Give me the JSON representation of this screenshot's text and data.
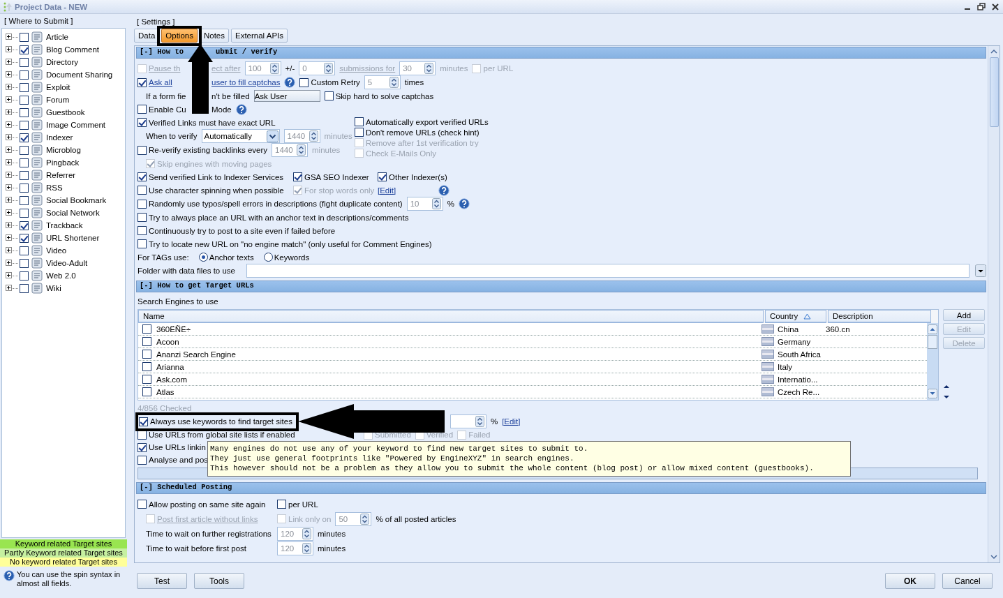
{
  "window": {
    "title": "Project Data - NEW"
  },
  "submit_panel": {
    "title": "[ Where to Submit ]",
    "items": [
      {
        "label": "Article",
        "checked": false
      },
      {
        "label": "Blog Comment",
        "checked": true
      },
      {
        "label": "Directory",
        "checked": false
      },
      {
        "label": "Document Sharing",
        "checked": false
      },
      {
        "label": "Exploit",
        "checked": false
      },
      {
        "label": "Forum",
        "checked": false
      },
      {
        "label": "Guestbook",
        "checked": false
      },
      {
        "label": "Image Comment",
        "checked": false
      },
      {
        "label": "Indexer",
        "checked": true
      },
      {
        "label": "Microblog",
        "checked": false
      },
      {
        "label": "Pingback",
        "checked": false
      },
      {
        "label": "Referrer",
        "checked": false
      },
      {
        "label": "RSS",
        "checked": false
      },
      {
        "label": "Social Bookmark",
        "checked": false
      },
      {
        "label": "Social Network",
        "checked": false
      },
      {
        "label": "Trackback",
        "checked": true
      },
      {
        "label": "URL Shortener",
        "checked": true
      },
      {
        "label": "Video",
        "checked": false
      },
      {
        "label": "Video-Adult",
        "checked": false
      },
      {
        "label": "Web 2.0",
        "checked": false
      },
      {
        "label": "Wiki",
        "checked": false
      }
    ],
    "legend": [
      {
        "label": "Keyword related Target sites",
        "color": "#99e550"
      },
      {
        "label": "Partly Keyword related Target sites",
        "color": "#c6f0a0"
      },
      {
        "label": "No keyword related Target sites",
        "color": "#ffff99"
      }
    ],
    "hint": "You can use the spin syntax in almost all fields."
  },
  "settings": {
    "title": "[ Settings ]",
    "tabs": [
      {
        "label": "Data",
        "selected": false,
        "annotated": false
      },
      {
        "label": "Options",
        "selected": true,
        "annotated": true
      },
      {
        "label": "Notes",
        "selected": false,
        "annotated": false
      },
      {
        "label": "External APIs",
        "selected": false,
        "annotated": false
      }
    ],
    "sections": [
      {
        "title_parts": [
          "[-] How to",
          "ubmit / verify"
        ],
        "rows": [
          {
            "kind": "flow",
            "items": [
              {
                "kind": "check",
                "label_parts": [
                  "Pause th",
                  "ect after"
                ],
                "checked": false,
                "disabled": true,
                "link": true
              },
              {
                "kind": "spin",
                "value": "100"
              },
              {
                "kind": "text",
                "text": "+/-"
              },
              {
                "kind": "spin",
                "value": "0"
              },
              {
                "kind": "link",
                "text": "submissions for",
                "disabled": true
              },
              {
                "kind": "spin",
                "value": "30"
              },
              {
                "kind": "text",
                "text": "minutes",
                "disabled": true
              },
              {
                "kind": "check",
                "label": "per URL",
                "checked": false,
                "disabled": true,
                "link": false
              }
            ]
          },
          {
            "kind": "flow",
            "items": [
              {
                "kind": "check",
                "label_parts": [
                  "Ask all",
                  "user to fill captchas"
                ],
                "checked": true,
                "disabled": false,
                "link": true
              },
              {
                "kind": "help"
              },
              {
                "kind": "check",
                "label": "Custom Retry",
                "checked": false,
                "disabled": false,
                "link": false
              },
              {
                "kind": "spin",
                "value": "5"
              },
              {
                "kind": "text",
                "text": "times"
              }
            ]
          },
          {
            "kind": "flow",
            "items": [
              {
                "kind": "text",
                "text_parts": [
                  "If a form fie",
                  "n't be filled"
                ],
                "indent": true
              },
              {
                "kind": "button",
                "text": "Ask User"
              },
              {
                "kind": "check",
                "label": "Skip hard to solve captchas",
                "checked": false,
                "disabled": false,
                "link": false
              }
            ]
          },
          {
            "kind": "flow",
            "items": [
              {
                "kind": "check",
                "label_parts": [
                  "Enable Cu",
                  "Mode"
                ],
                "checked": false,
                "disabled": false,
                "link": false
              },
              {
                "kind": "help"
              }
            ]
          },
          {
            "kind": "split",
            "left": [
              {
                "kind": "flow",
                "items": [
                  {
                    "kind": "check",
                    "label": "Verified Links must have exact URL",
                    "checked": true,
                    "disabled": false,
                    "link": false
                  }
                ]
              },
              {
                "kind": "flow",
                "items": [
                  {
                    "kind": "text",
                    "text": "When to verify",
                    "indent": true
                  },
                  {
                    "kind": "combo",
                    "value": "Automatically"
                  },
                  {
                    "kind": "spin",
                    "value": "1440"
                  },
                  {
                    "kind": "text",
                    "text": "minutes",
                    "disabled": true
                  }
                ]
              },
              {
                "kind": "flow",
                "items": [
                  {
                    "kind": "check",
                    "label": "Re-verify existing backlinks every",
                    "checked": false,
                    "disabled": false,
                    "link": false
                  },
                  {
                    "kind": "spin",
                    "value": "1440"
                  },
                  {
                    "kind": "text",
                    "text": "minutes",
                    "disabled": true
                  }
                ]
              },
              {
                "kind": "flow",
                "items": [
                  {
                    "kind": "check",
                    "label": "Skip engines with moving pages",
                    "checked": true,
                    "disabled": true,
                    "link": false,
                    "indent": true
                  }
                ]
              }
            ],
            "right": [
              {
                "kind": "flow",
                "items": [
                  {
                    "kind": "check",
                    "label": "Automatically export verified URLs",
                    "checked": false,
                    "disabled": false,
                    "link": false
                  }
                ]
              },
              {
                "kind": "flow",
                "items": [
                  {
                    "kind": "check",
                    "label": "Don't remove URLs (check hint)",
                    "checked": false,
                    "disabled": false,
                    "link": false
                  }
                ]
              },
              {
                "kind": "flow",
                "items": [
                  {
                    "kind": "check",
                    "label": "Remove after 1st verification try",
                    "checked": false,
                    "disabled": true,
                    "link": false
                  }
                ]
              },
              {
                "kind": "flow",
                "items": [
                  {
                    "kind": "check",
                    "label": "Check E-Mails Only",
                    "checked": false,
                    "disabled": true,
                    "link": false
                  }
                ]
              }
            ]
          },
          {
            "kind": "grid",
            "items": [
              {
                "kind": "check",
                "label": "Send verified Link to Indexer Services",
                "checked": true,
                "disabled": false,
                "link": false
              },
              {
                "kind": "check",
                "label": "GSA SEO Indexer",
                "checked": true,
                "disabled": false,
                "link": false
              },
              {
                "kind": "check",
                "label": "Other Indexer(s)",
                "checked": true,
                "disabled": false,
                "link": false
              }
            ]
          },
          {
            "kind": "grid",
            "items": [
              {
                "kind": "check",
                "label": "Use character spinning when possible",
                "checked": false,
                "disabled": false,
                "link": false
              },
              {
                "kind": "check",
                "label": "For stop words only",
                "checked": true,
                "disabled": true,
                "link": false
              },
              {
                "kind": "link",
                "text": "[Edit]",
                "disabled": false
              },
              {
                "kind": "help"
              }
            ]
          },
          {
            "kind": "flow",
            "items": [
              {
                "kind": "check",
                "label": "Randomly use typos/spell errors in descriptions (fight duplicate content)",
                "checked": false,
                "disabled": false,
                "link": false
              },
              {
                "kind": "spin",
                "value": "10"
              },
              {
                "kind": "text",
                "text": "%"
              },
              {
                "kind": "help"
              }
            ]
          },
          {
            "kind": "flow",
            "items": [
              {
                "kind": "check",
                "label": "Try to always place an URL with an anchor text in descriptions/comments",
                "checked": false,
                "disabled": false,
                "link": false
              }
            ]
          },
          {
            "kind": "flow",
            "items": [
              {
                "kind": "check",
                "label": "Continuously try to post to a site even if failed before",
                "checked": false,
                "disabled": false,
                "link": false
              }
            ]
          },
          {
            "kind": "flow",
            "items": [
              {
                "kind": "check",
                "label": "Try to locate new URL on \"no engine match\" (only useful for Comment Engines)",
                "checked": false,
                "disabled": false,
                "link": false
              }
            ]
          },
          {
            "kind": "flow",
            "items": [
              {
                "kind": "text",
                "text": "For TAGs use:"
              },
              {
                "kind": "radio",
                "label": "Anchor texts",
                "selected": true
              },
              {
                "kind": "radio",
                "label": "Keywords",
                "selected": false
              }
            ]
          },
          {
            "kind": "flow",
            "items": [
              {
                "kind": "text",
                "text": "Folder with  data files to use"
              },
              {
                "kind": "combo"
              }
            ]
          }
        ]
      },
      {
        "title": "[-] How to get Target URLs",
        "rows": [
          {
            "kind": "flow",
            "items": [
              {
                "kind": "text",
                "text": "Search Engines to use"
              }
            ]
          },
          {
            "kind": "table",
            "columns": [
              {
                "label": "Name",
                "sorted": false
              },
              {
                "label": "Country",
                "sorted": true
              },
              {
                "label": "Description",
                "sorted": false
              }
            ],
            "rows": [
              {
                "checked": false,
                "name": "360ËÑË÷",
                "country": "China",
                "description": "360.cn"
              },
              {
                "checked": false,
                "name": "Acoon",
                "country": "Germany"
              },
              {
                "checked": false,
                "name": "Ananzi Search Engine",
                "country": "South Africa"
              },
              {
                "checked": false,
                "name": "Arianna",
                "country": "Italy"
              },
              {
                "checked": false,
                "name": "Ask.com",
                "country": "Internatio..."
              },
              {
                "checked": false,
                "name": "Atlas",
                "country": "Czech Re..."
              }
            ],
            "buttons": [
              {
                "label": "Add",
                "disabled": false
              },
              {
                "label": "Edit",
                "disabled": true
              },
              {
                "label": "Delete",
                "disabled": true
              }
            ]
          },
          {
            "kind": "flow",
            "items": [
              {
                "kind": "text",
                "text": "4/856 Checked",
                "disabled": true
              }
            ]
          },
          {
            "kind": "flow",
            "items": [
              {
                "kind": "check",
                "label": "Always use keywords to find target sites",
                "checked": true,
                "disabled": false,
                "link": false,
                "annotated": true
              },
              {
                "kind": "spin"
              },
              {
                "kind": "text",
                "text": "%"
              },
              {
                "kind": "link",
                "text": "[Edit]",
                "disabled": false
              }
            ]
          },
          {
            "kind": "columns",
            "items": [
              {
                "kind": "check",
                "label": "Use URLs from global site lists if enabled",
                "checked": false,
                "disabled": false,
                "link": false
              },
              {
                "kind": "check",
                "label": "Submitted",
                "checked": false,
                "disabled": true,
                "link": false
              },
              {
                "kind": "check",
                "label": "Verified",
                "checked": false,
                "disabled": true,
                "link": false
              },
              {
                "kind": "check",
                "label": "Failed",
                "checked": false,
                "disabled": true,
                "link": false
              }
            ]
          },
          {
            "kind": "flow",
            "items": [
              {
                "kind": "check",
                "label": "Use URLs linkin",
                "checked": true,
                "disabled": false,
                "link": false
              }
            ],
            "tooltip": [
              "Many engines do not use any of your keyword to find new target sites to submit to.",
              "They just use general footprints like \"Powered by EngineXYZ\" in search engines.",
              "This however should not be a problem as they allow you to submit the whole content (blog post) or allow mixed content (guestbooks)."
            ]
          },
          {
            "kind": "flow",
            "items": [
              {
                "kind": "check",
                "label": "Analyse and pos",
                "checked": false,
                "disabled": false,
                "link": false
              }
            ]
          },
          {
            "kind": "bar"
          }
        ]
      },
      {
        "title": "[-] Scheduled Posting",
        "rows": [
          {
            "kind": "columns",
            "items": [
              {
                "kind": "check",
                "label": "Allow posting on same site again",
                "checked": false,
                "disabled": false,
                "link": false
              },
              {
                "kind": "check",
                "label": "per URL",
                "checked": false,
                "disabled": false,
                "link": false
              }
            ]
          },
          {
            "kind": "columns",
            "items": [
              {
                "kind": "check",
                "label": "Post first article without links",
                "checked": false,
                "disabled": true,
                "link": true,
                "indent": true
              },
              {
                "kind": "check",
                "label": "Link only on",
                "checked": false,
                "disabled": true,
                "link": false
              },
              {
                "kind": "spin",
                "value": "50"
              },
              {
                "kind": "text",
                "text": "% of all posted articles"
              }
            ]
          },
          {
            "kind": "columns",
            "items": [
              {
                "kind": "text",
                "text": "Time to wait on further registrations",
                "indent": true
              },
              {
                "kind": "spin",
                "value": "120"
              },
              {
                "kind": "text",
                "text": "minutes"
              }
            ]
          },
          {
            "kind": "columns",
            "items": [
              {
                "kind": "text",
                "text": "Time to wait before first post",
                "indent": true
              },
              {
                "kind": "spin",
                "value": "120"
              },
              {
                "kind": "text",
                "text": "minutes"
              }
            ]
          }
        ]
      }
    ]
  },
  "buttons": [
    {
      "label": "Test",
      "default": false
    },
    {
      "label": "Tools",
      "default": false
    },
    {
      "label": "OK",
      "default": true
    },
    {
      "label": "Cancel",
      "default": false
    }
  ]
}
